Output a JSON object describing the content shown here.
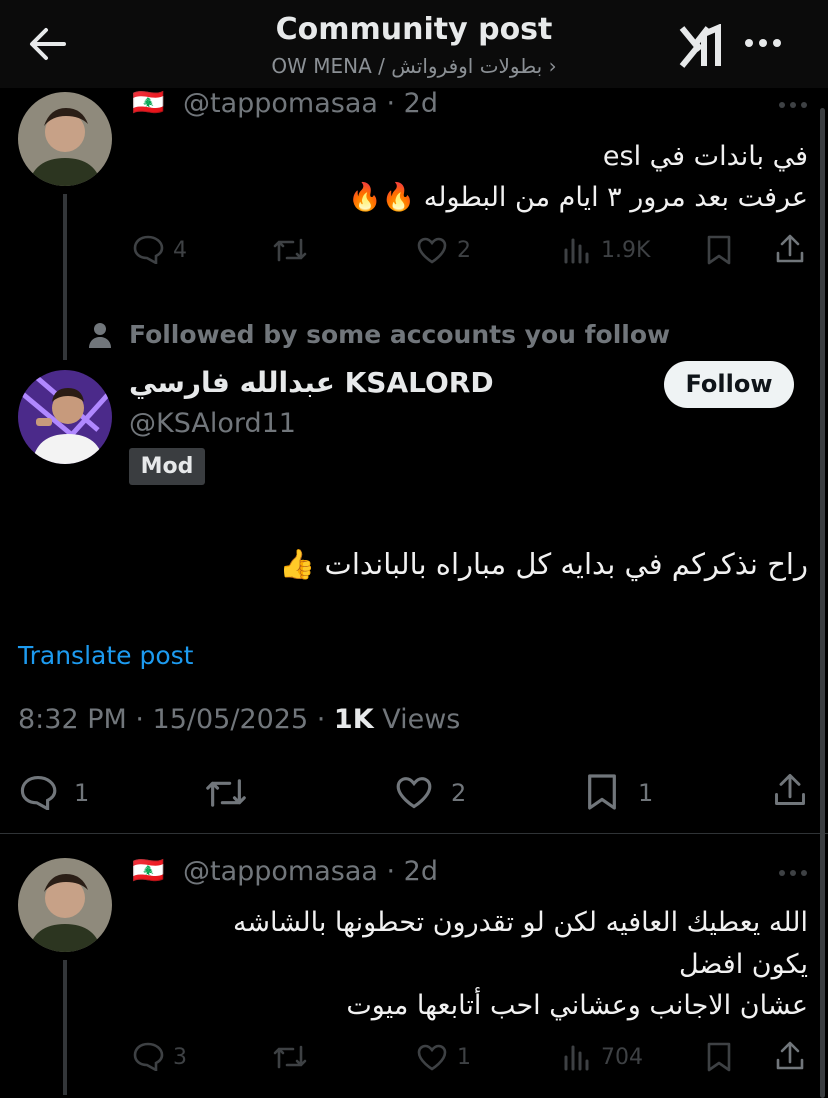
{
  "header": {
    "title": "Community post",
    "subtitle": "OW MENA / بطولات اوفرواتش ›"
  },
  "colors": {
    "background": "#000000",
    "link": "#1d9bf0",
    "muted": "#71767b",
    "follow_bg": "#eff3f4"
  },
  "post1": {
    "flag": "🇱🇧",
    "handle": "@tappomasaa · 2d",
    "lines": [
      "في باندات في esl",
      "عرفت بعد مرور ٣ ايام من البطوله 🔥🔥"
    ],
    "stats": {
      "replies": "4",
      "likes": "2",
      "views": "1.9K"
    }
  },
  "main_post": {
    "social_context": "Followed by some accounts you follow",
    "display_name": "عبدالله فارسي KSALORD",
    "handle": "@KSAlord11",
    "badge": "Mod",
    "follow_label": "Follow",
    "text": "راح نذكركم في بدايه كل مباراه بالباندات 👍",
    "translate": "Translate post",
    "meta_time": "8:32 PM · 15/05/2025 · ",
    "meta_views_count": "1K",
    "meta_views_label": " Views",
    "stats": {
      "replies": "1",
      "likes": "2",
      "bookmarks": "1"
    }
  },
  "post2": {
    "flag": "🇱🇧",
    "handle": "@tappomasaa · 2d",
    "lines": [
      "الله يعطيك العافيه لكن لو تقدرون تحطونها بالشاشه",
      "يكون افضل",
      "عشان الاجانب وعشاني احب أتابعها ميوت"
    ],
    "stats": {
      "replies": "3",
      "likes": "1",
      "views": "704"
    }
  }
}
